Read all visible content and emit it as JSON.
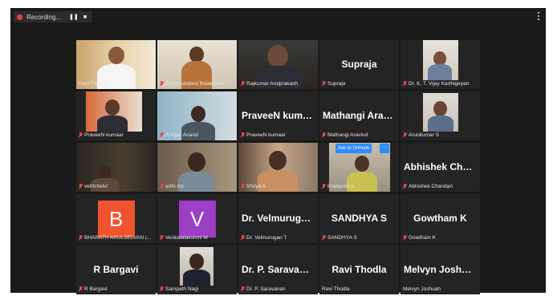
{
  "recording": {
    "label": "Recording...",
    "pause_glyph": "❚❚",
    "stop_glyph": "■"
  },
  "unmute": {
    "label": "Ask to Unmute",
    "more_glyph": "···"
  },
  "colors": {
    "accent": "#2d8cff",
    "muted_mic": "#e5484d",
    "avatar_orange": "#f0542e",
    "avatar_purple": "#9c3fc5"
  },
  "tiles": [
    {
      "label": "Ravi Thodla",
      "muted": false
    },
    {
      "label": "Shyamaladevi Balakrishn...",
      "muted": true
    },
    {
      "label": "Rajkumar Arulprakash",
      "muted": true
    },
    {
      "name": "Supraja",
      "label": "Supraja",
      "muted": true
    },
    {
      "label": "Dr. K. T. Vijay Karthigeyan",
      "muted": true
    },
    {
      "label": "PraveeN kumaar",
      "muted": true
    },
    {
      "label": "R Vijay Anand",
      "muted": true
    },
    {
      "name": "PraveeN kumaar",
      "label": "PraveeN kumaar",
      "muted": true
    },
    {
      "name": "Mathangi Aravi...",
      "label": "Mathangi Aravind",
      "muted": true
    },
    {
      "label": "Arunkumar S",
      "muted": true
    },
    {
      "label": "vetrichelvi",
      "muted": true
    },
    {
      "label": "arthi mc",
      "muted": true
    },
    {
      "label": "Shriya K",
      "muted": true
    },
    {
      "label": "Pradyumna",
      "muted": true
    },
    {
      "name": "Abhishek Chan...",
      "label": "Abhishek Chandan",
      "muted": true
    },
    {
      "avatar": "B",
      "label": "BHARATH ARULSELVAN (...",
      "muted": true
    },
    {
      "avatar": "V",
      "label": "Venkatalakshmi M",
      "muted": true
    },
    {
      "name": "Dr. Velmurugan T",
      "label": "Dr. Velmurugan T",
      "muted": true
    },
    {
      "name": "SANDHYA S",
      "label": "SANDHYA S",
      "muted": true
    },
    {
      "name": "Gowtham K",
      "label": "Gowtham K",
      "muted": true
    },
    {
      "name": "R Bargavi",
      "label": "R Bargavi",
      "muted": true
    },
    {
      "label": "Sampath Nagi",
      "muted": true
    },
    {
      "name": "Dr. P. Saravanan",
      "label": "Dr. P. Saravanan",
      "muted": true
    },
    {
      "name": "Ravi Thodla",
      "label": "Ravi Thodla",
      "muted": false
    },
    {
      "name": "Melvyn Joshuah",
      "label": "Melvyn Joshuah",
      "muted": false
    }
  ]
}
